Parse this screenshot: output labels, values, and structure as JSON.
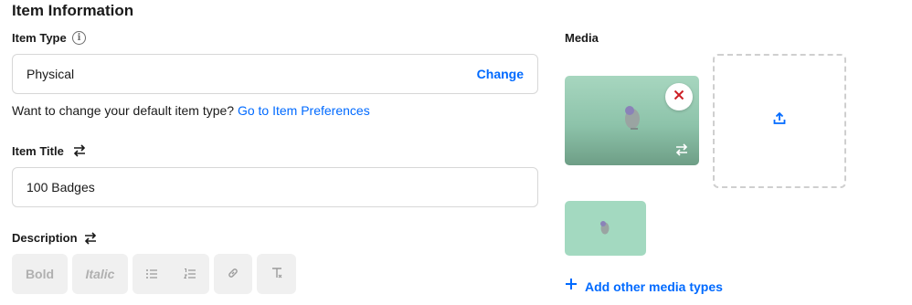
{
  "section": {
    "title": "Item Information"
  },
  "item_type": {
    "label": "Item Type",
    "info_icon": "info-icon",
    "value": "Physical",
    "change_label": "Change",
    "helper_text": "Want to change your default item type?",
    "helper_link": "Go to Item Preferences"
  },
  "item_title": {
    "label": "Item Title",
    "swap_icon": "swap-arrows-icon",
    "value": "100 Badges"
  },
  "description": {
    "label": "Description",
    "swap_icon": "swap-arrows-icon",
    "toolbar": {
      "bold": "Bold",
      "italic": "Italic",
      "bullet_list_icon": "bulleted-list-icon",
      "numbered_list_icon": "numbered-list-icon",
      "link_icon": "link-icon",
      "clear_format_icon": "clear-format-icon"
    }
  },
  "media": {
    "label": "Media",
    "remove_icon": "close-icon",
    "replace_icon": "swap-arrows-icon",
    "upload_icon": "upload-icon",
    "add_other_label": "Add other media types",
    "add_icon": "plus-icon"
  },
  "colors": {
    "accent": "#006aff",
    "remove_red": "#cd2026",
    "thumb_green": "#a3d9c0",
    "toolbar_bg": "#f0f0f0"
  }
}
